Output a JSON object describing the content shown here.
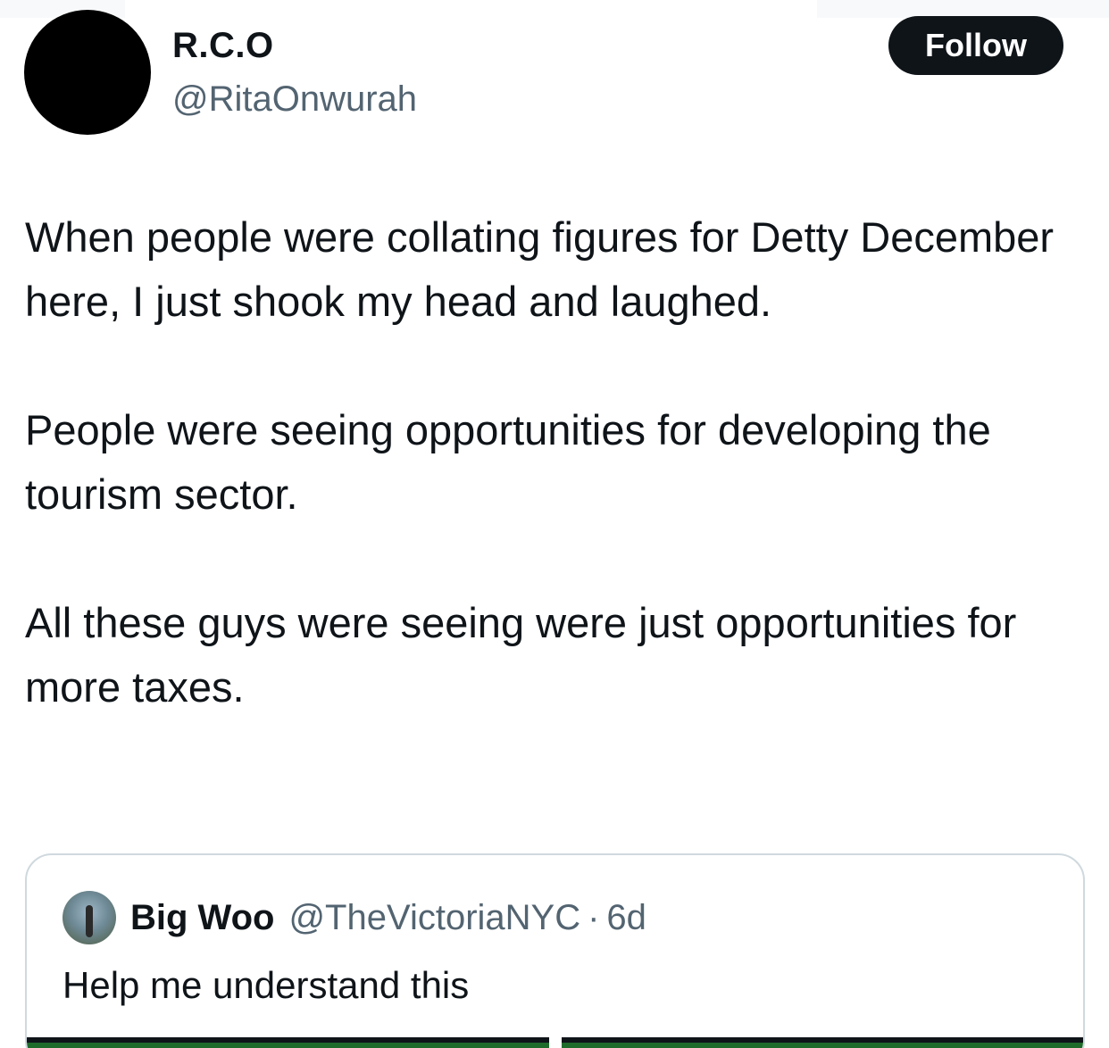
{
  "tweet": {
    "author": {
      "display_name": "R.C.O",
      "handle": "@RitaOnwurah",
      "avatar_icon": "avatar-image"
    },
    "follow_label": "Follow",
    "paragraphs": [
      "When people were collating figures for Detty December here, I just shook my head and laughed.",
      "People were seeing opportunities for developing the tourism sector.",
      "All these guys were seeing were just opportunities for more taxes."
    ]
  },
  "quoted_tweet": {
    "author": {
      "display_name": "Big Woo",
      "handle": "@TheVictoriaNYC",
      "separator": "·",
      "time": "6d",
      "avatar_icon": "avatar-image"
    },
    "text": "Help me understand this"
  },
  "colors": {
    "text_primary": "#0f1419",
    "text_secondary": "#536471",
    "border": "#cfd9de",
    "follow_bg": "#0f1419",
    "follow_text": "#ffffff",
    "media_green": "#1f6b2a"
  }
}
